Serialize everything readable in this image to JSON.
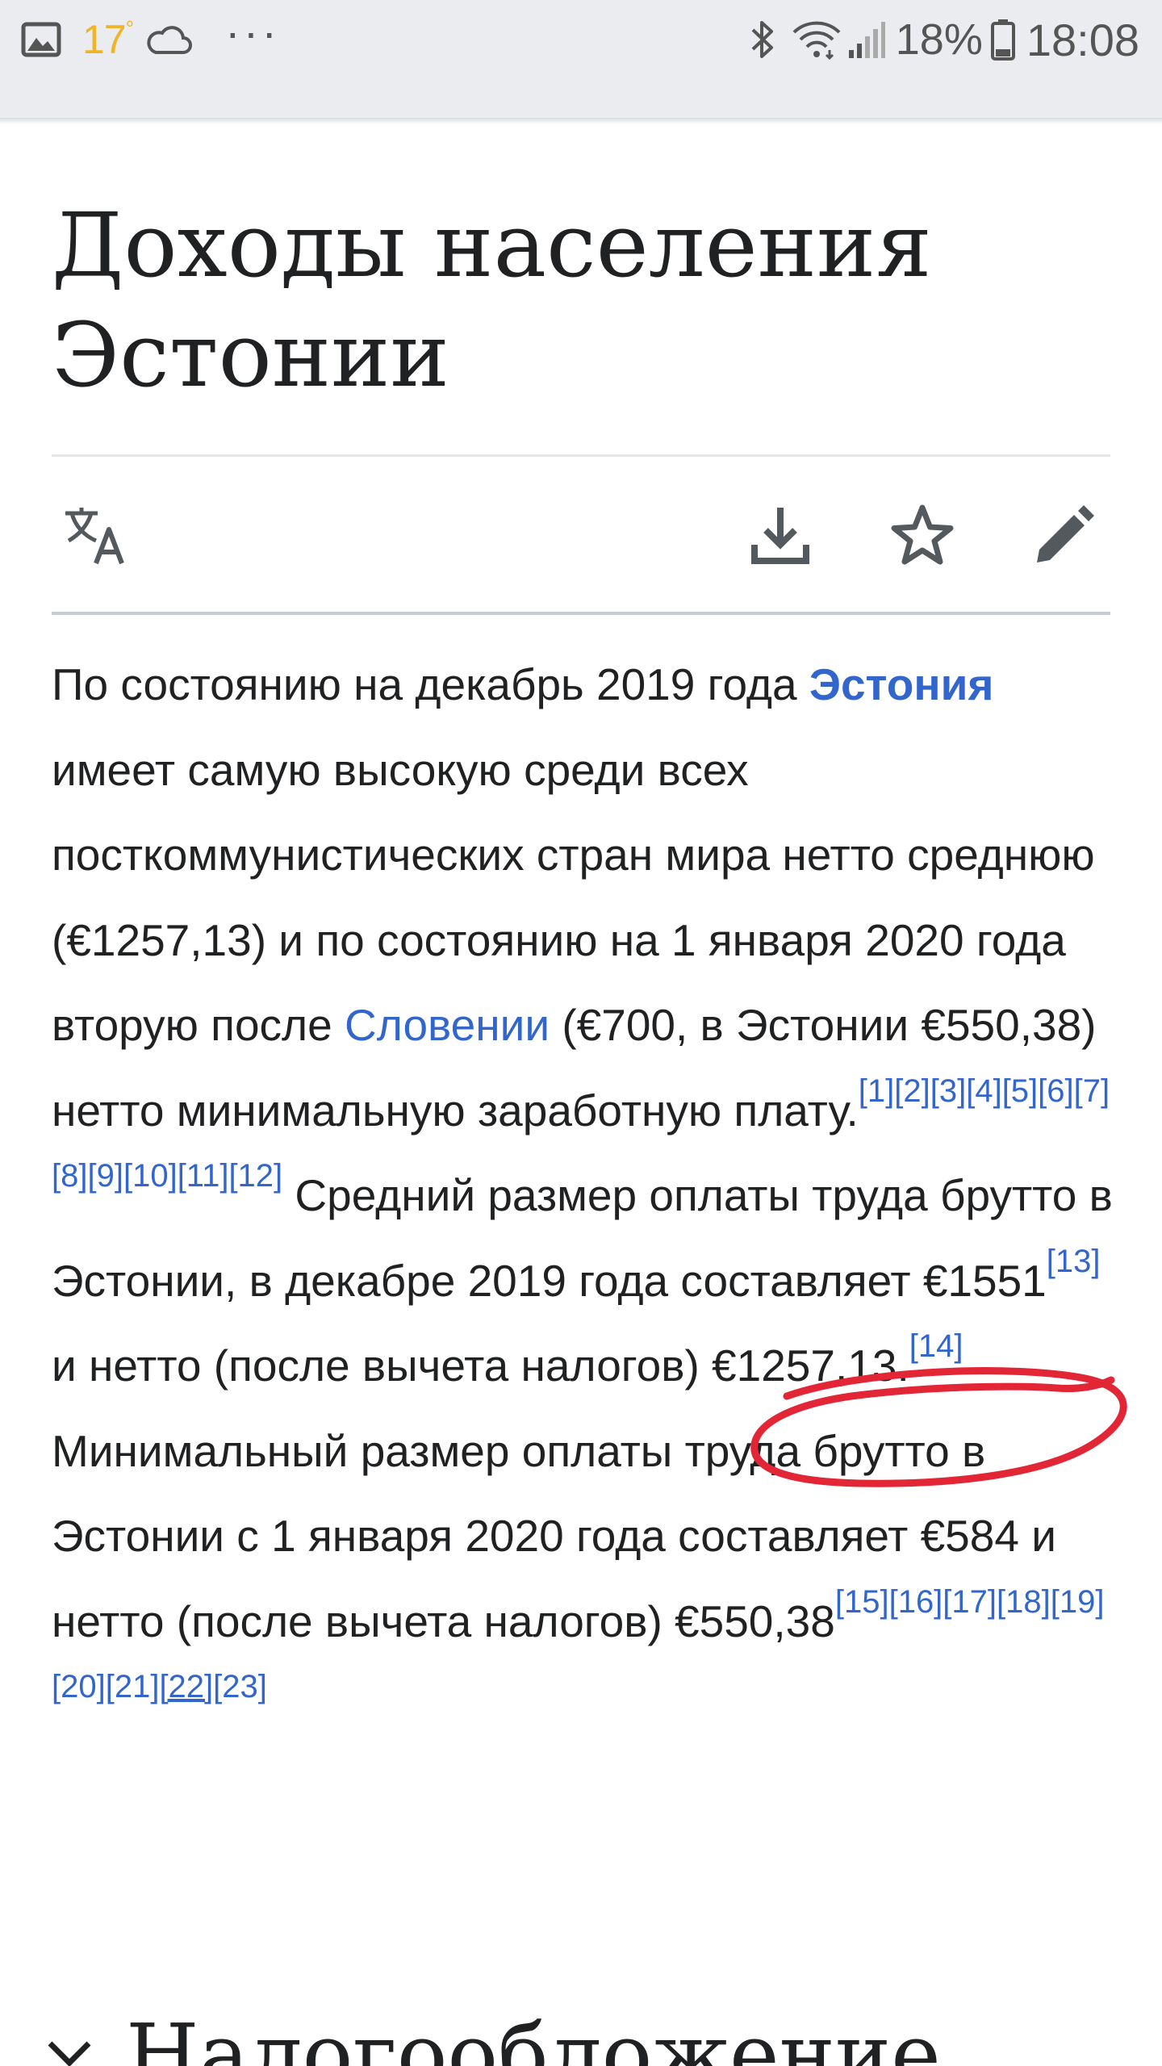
{
  "status_bar": {
    "temperature": "17",
    "degree": "°",
    "more": "···",
    "battery_percent": "18%",
    "time": "18:08",
    "icons": [
      "gallery-icon",
      "cloud-icon",
      "bluetooth-icon",
      "wifi-icon",
      "signal-icon",
      "battery-icon"
    ]
  },
  "article": {
    "title": "Доходы населения Эстонии",
    "toolbar": {
      "icons": [
        "translate-icon",
        "download-icon",
        "star-icon",
        "edit-icon"
      ]
    },
    "paragraph": {
      "t1": "По состоянию на декабрь 2019 года ",
      "link_estonia": "Эстония",
      "t2": " имеет самую высокую среди всех посткоммунистических стран мира нетто среднюю (€1257,13) и по состоянию на 1 января 2020 года вторую после ",
      "link_slovenia": "Словении",
      "t3": " (€700, в Эстонии €550,38) нетто минимальную заработную плату.",
      "refs_a": [
        "[1]",
        "[2]",
        "[3]",
        "[4]",
        "[5]",
        "[6]",
        "[7]",
        "[8]",
        "[9]",
        "[10]",
        "[11]",
        "[12]"
      ],
      "t4": " Средний размер оплаты труда брутто в Эстонии, в декабре 2019 года составляет €1551",
      "ref_13": "[13]",
      "t5": " и нетто (после вычета налогов) €1257,13.",
      "ref_14": "[14]",
      "t6": " Минимальный размер оплаты труда брутто в Эстонии с 1 января 2020 года составляет €584 и нетто (после вычета налогов) €550,38",
      "refs_b": [
        "[15]",
        "[16]",
        "[17]",
        "[18]",
        "[19]",
        "[20]",
        "[21]",
        "[22]",
        "[23]"
      ]
    },
    "next_section": "Налогообложение"
  },
  "colors": {
    "link": "#3366cc",
    "text": "#202122",
    "annotation": "#e32636",
    "status_bar_bg": "#eaecf0"
  }
}
